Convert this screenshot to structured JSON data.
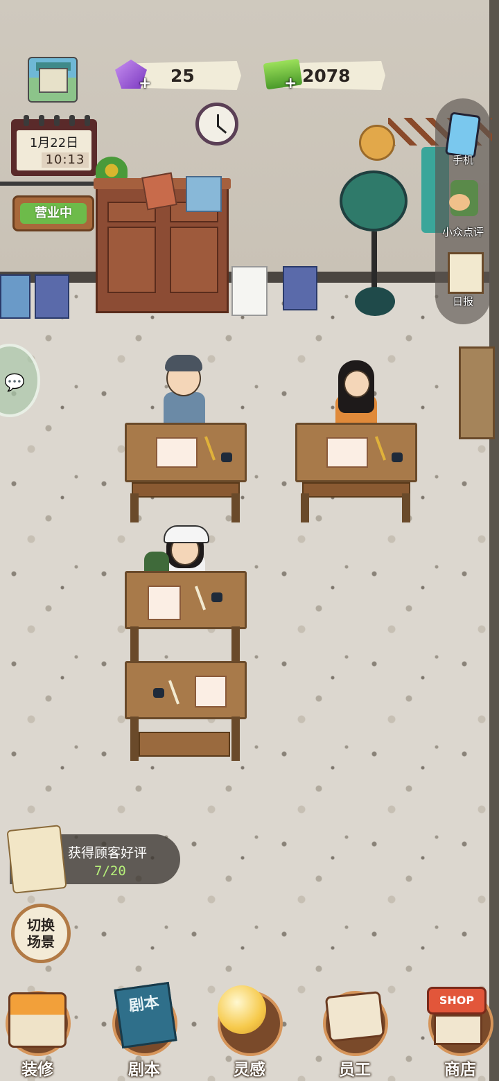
{
  "resources": {
    "gems": "25",
    "cash": "2078",
    "plus_symbol": "+"
  },
  "calendar": {
    "date": "1月22日",
    "time": "10:13"
  },
  "status_sign": "营业中",
  "side_menu": {
    "phone": "手机",
    "reviews": "小众点评",
    "daily": "日报"
  },
  "quest": {
    "title": "获得顾客好评",
    "progress": "7/20"
  },
  "switch_scene": {
    "line1": "切换",
    "line2": "场景"
  },
  "bottom_nav": [
    {
      "label": "装修",
      "icon": "house-icon"
    },
    {
      "label": "剧本",
      "icon": "script-book-icon",
      "art_text": "剧本"
    },
    {
      "label": "灵感",
      "icon": "lightbulb-icon"
    },
    {
      "label": "员工",
      "icon": "staff-badge-icon"
    },
    {
      "label": "商店",
      "icon": "shop-icon",
      "art_text": "SHOP"
    }
  ],
  "colors": {
    "accent_green": "#6dbb4a",
    "quest_progress": "#b6f07a",
    "nav_ring": "#d6955a"
  }
}
